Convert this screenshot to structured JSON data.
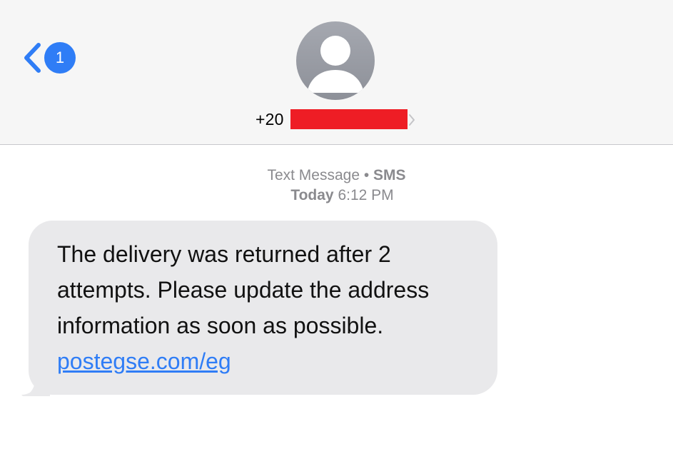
{
  "header": {
    "back": {
      "unread_count": "1"
    },
    "contact": {
      "prefix": "+20",
      "redacted": true
    }
  },
  "conversation": {
    "service": "Text Message",
    "separator": "•",
    "protocol": "SMS",
    "date_label": "Today",
    "time": "6:12 PM"
  },
  "messages": [
    {
      "direction": "incoming",
      "text": "The delivery was returned after 2 attempts. Please update the address information as soon as possible.",
      "link": "postegse.com/eg"
    }
  ],
  "colors": {
    "accent": "#2f7df6",
    "bubble_incoming": "#e9e9eb",
    "redaction": "#ee1d25",
    "meta_text": "#8a8a8e"
  }
}
